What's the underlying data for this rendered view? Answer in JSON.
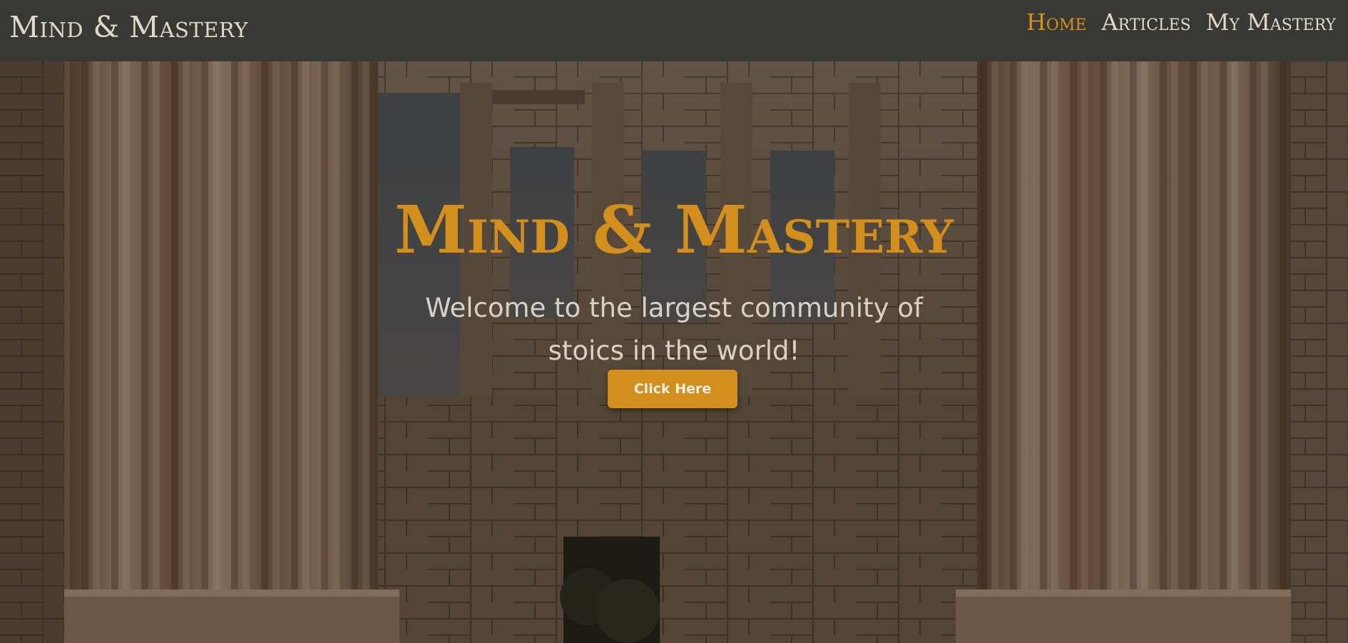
{
  "header": {
    "brand": "Mind & Mastery",
    "nav": [
      {
        "label": "Home",
        "active": true
      },
      {
        "label": "Articles",
        "active": false
      },
      {
        "label": "My Mastery",
        "active": false
      }
    ]
  },
  "hero": {
    "title": "Mind & Mastery",
    "subtitle": "Welcome to the largest community of stoics in the world!",
    "cta_label": "Click Here"
  },
  "colors": {
    "accent": "#d28f1d",
    "header_bg": "#383835",
    "nav_text": "#e1d8c8",
    "subtitle_text": "#d8d1c6"
  }
}
